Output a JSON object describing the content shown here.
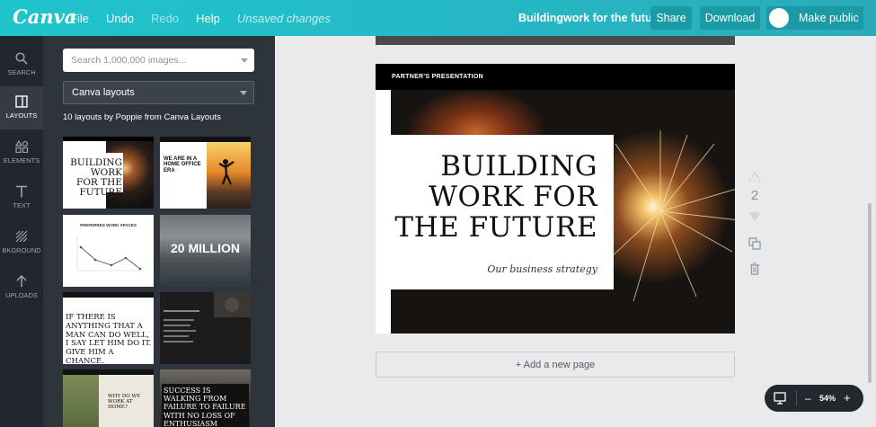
{
  "topbar": {
    "logo": "Canva",
    "menu": {
      "file": "File",
      "undo": "Undo",
      "redo": "Redo",
      "help": "Help",
      "status": "Unsaved changes"
    },
    "doc_title": "Buildingwork for the future",
    "share": "Share",
    "download": "Download",
    "make_public": "Make public"
  },
  "rail": {
    "search": "SEARCH",
    "layouts": "LAYOUTS",
    "elements": "ELEMENTS",
    "text": "TEXT",
    "background": "BKGROUND",
    "uploads": "UPLOADS"
  },
  "panel": {
    "search_placeholder": "Search 1,000,000 images...",
    "dropdown": "Canva layouts",
    "count": "10 layouts by Poppie from Canva Layouts",
    "thumbs": {
      "t1": "BUILDING WORK FOR THE FUTURE",
      "t2": "WE ARE IN A HOME OFFICE ERA",
      "t3": "PREFERRED WORK SPACES",
      "t4": "20 MILLION",
      "t5": "IF THERE IS ANYTHING THAT A MAN CAN DO WELL, I SAY LET HIM DO IT. GIVE HIM A CHANCE.",
      "t7": "WHY DO WE WORK AT HOME?",
      "t8": "SUCCESS IS WALKING FROM FAILURE TO FAILURE WITH NO LOSS OF ENTHUSIASM"
    }
  },
  "page": {
    "header": "PARTNER'S PRESENTATION",
    "headline_1": "BUILDING",
    "headline_2": "WORK FOR",
    "headline_3": "THE FUTURE",
    "tagline": "Our business strategy",
    "page_number": "2"
  },
  "add_page": "+ Add a new page",
  "zoom": {
    "minus": "–",
    "value": "54%",
    "plus": "+"
  },
  "colors": {
    "brand": "#20c4cb",
    "dark_panel": "#2e343c",
    "rail": "#22272e"
  }
}
